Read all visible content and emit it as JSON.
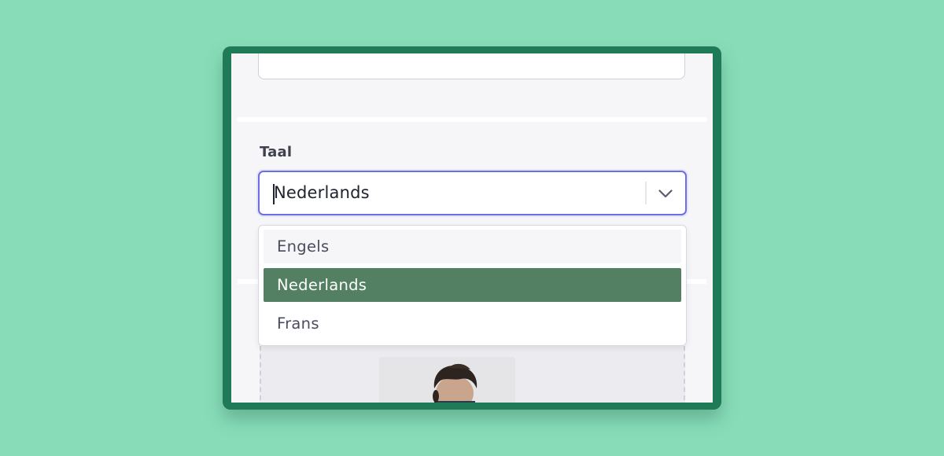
{
  "language_field": {
    "label": "Taal",
    "selected_value": "Nederlands",
    "options": [
      {
        "label": "Engels",
        "state": "hover"
      },
      {
        "label": "Nederlands",
        "state": "selected"
      },
      {
        "label": "Frans",
        "state": "normal"
      }
    ]
  },
  "icons": {
    "dropdown_indicator": "chevron-down-icon"
  },
  "colors": {
    "background": "#88ddb8",
    "frame": "#1f7a58",
    "focus_border": "#6d6ee3",
    "selected_option": "#537f63"
  }
}
